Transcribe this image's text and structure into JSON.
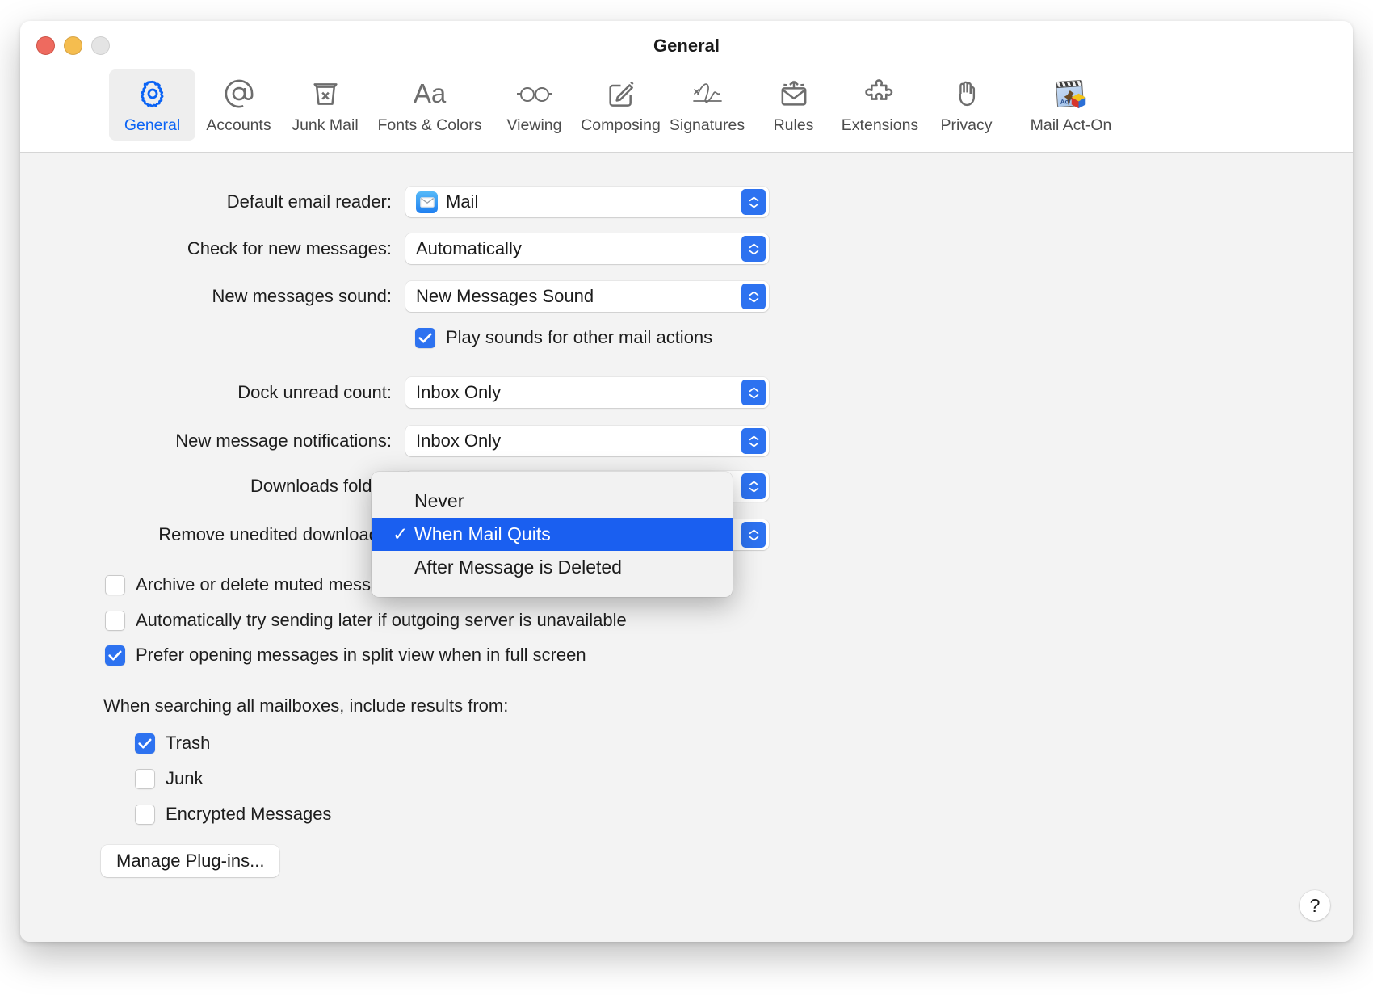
{
  "window": {
    "title": "General",
    "traffic_lights": [
      "close",
      "minimize",
      "zoom"
    ]
  },
  "toolbar": {
    "tabs": [
      {
        "label": "General",
        "icon": "gear-icon",
        "selected": true
      },
      {
        "label": "Accounts",
        "icon": "at-sign-icon",
        "selected": false
      },
      {
        "label": "Junk Mail",
        "icon": "junk-bin-icon",
        "selected": false
      },
      {
        "label": "Fonts & Colors",
        "icon": "aa-text-icon",
        "selected": false
      },
      {
        "label": "Viewing",
        "icon": "glasses-icon",
        "selected": false
      },
      {
        "label": "Composing",
        "icon": "compose-pencil-icon",
        "selected": false
      },
      {
        "label": "Signatures",
        "icon": "signature-icon",
        "selected": false
      },
      {
        "label": "Rules",
        "icon": "rules-envelope-icon",
        "selected": false
      },
      {
        "label": "Extensions",
        "icon": "puzzle-piece-icon",
        "selected": false
      },
      {
        "label": "Privacy",
        "icon": "hand-icon",
        "selected": false
      },
      {
        "label": "Mail Act-On",
        "icon": "mail-act-on-app-icon",
        "selected": false
      }
    ]
  },
  "form": {
    "default_email_reader": {
      "label": "Default email reader:",
      "value": "Mail",
      "icon": "mail-app-icon"
    },
    "check_new_messages": {
      "label": "Check for new messages:",
      "value": "Automatically"
    },
    "new_messages_sound": {
      "label": "New messages sound:",
      "value": "New Messages Sound"
    },
    "play_sounds": {
      "label": "Play sounds for other mail actions",
      "checked": true
    },
    "dock_unread_count": {
      "label": "Dock unread count:",
      "value": "Inbox Only"
    },
    "new_message_notifications": {
      "label": "New message notifications:",
      "value": "Inbox Only"
    },
    "downloads_folder": {
      "label": "Downloads folder"
    },
    "remove_unedited_downloads": {
      "label": "Remove unedited downloads"
    }
  },
  "dropdown": {
    "open": true,
    "items": [
      {
        "label": "Never",
        "checked": false,
        "highlighted": false
      },
      {
        "label": "When Mail Quits",
        "checked": true,
        "highlighted": true
      },
      {
        "label": "After Message is Deleted",
        "checked": false,
        "highlighted": false
      }
    ],
    "check_glyph": "✓",
    "highlight_color": "#1a5ff0"
  },
  "options": [
    {
      "label": "Archive or delete muted messages",
      "checked": false
    },
    {
      "label": "Automatically try sending later if outgoing server is unavailable",
      "checked": false
    },
    {
      "label": "Prefer opening messages in split view when in full screen",
      "checked": true
    }
  ],
  "search_section": {
    "heading": "When searching all mailboxes, include results from:",
    "items": [
      {
        "label": "Trash",
        "checked": true
      },
      {
        "label": "Junk",
        "checked": false
      },
      {
        "label": "Encrypted Messages",
        "checked": false
      }
    ]
  },
  "footer": {
    "manage_plugins": "Manage Plug-ins...",
    "help": "?"
  },
  "colors": {
    "accent": "#2d72f0",
    "selected_tab_text": "#0a63f5",
    "menu_highlight": "#1a5ff0",
    "window_bg": "#f3f3f3"
  }
}
